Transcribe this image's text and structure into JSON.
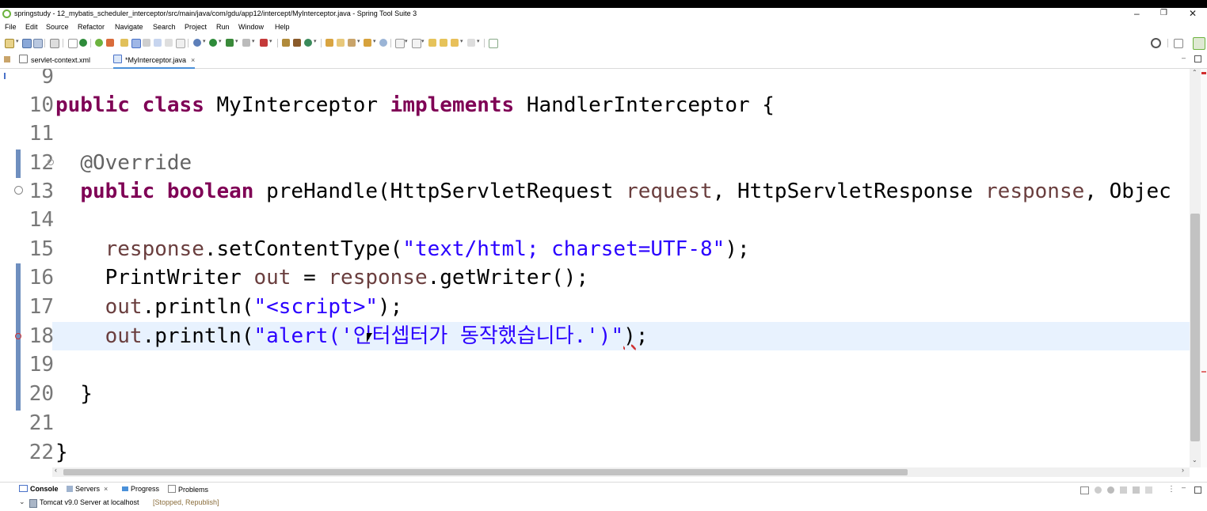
{
  "window": {
    "title": "springstudy - 12_mybatis_scheduler_interceptor/src/main/java/com/gdu/app12/intercept/MyInterceptor.java - Spring Tool Suite 3",
    "minimize": "–",
    "maximize": "❐",
    "close": "✕"
  },
  "menu": [
    "File",
    "Edit",
    "Source",
    "Refactor",
    "Navigate",
    "Search",
    "Project",
    "Run",
    "Window",
    "Help"
  ],
  "tabs": [
    {
      "label": "servlet-context.xml",
      "icon": "xml-file-icon"
    },
    {
      "label": "*MyInterceptor.java",
      "icon": "java-file-icon",
      "close": "×"
    }
  ],
  "editor": {
    "lines": [
      {
        "num": "9",
        "code": ""
      },
      {
        "num": "10",
        "code": "public class MyInterceptor implements HandlerInterceptor {"
      },
      {
        "num": "11",
        "code": ""
      },
      {
        "num": "12",
        "code": "  @Override"
      },
      {
        "num": "13",
        "code": "  public boolean preHandle(HttpServletRequest request, HttpServletResponse response, Objec"
      },
      {
        "num": "14",
        "code": ""
      },
      {
        "num": "15",
        "code": "    response.setContentType(\"text/html; charset=UTF-8\");"
      },
      {
        "num": "16",
        "code": "    PrintWriter out = response.getWriter();"
      },
      {
        "num": "17",
        "code": "    out.println(\"<script>\");"
      },
      {
        "num": "18",
        "code": "    out.println(\"alert('인터셉터가 동작했습니다.')\");"
      },
      {
        "num": "19",
        "code": ""
      },
      {
        "num": "20",
        "code": "  }"
      },
      {
        "num": "21",
        "code": ""
      },
      {
        "num": "22",
        "code": "}"
      }
    ],
    "current_line": "18"
  },
  "bottom_panel": {
    "tabs": [
      "Console",
      "Servers",
      "Progress",
      "Problems"
    ],
    "server_name": "Tomcat v9.0 Server at localhost",
    "server_state": "[Stopped, Republish]"
  },
  "colors": {
    "keyword": "#7f0055",
    "string": "#2a00ff",
    "variable": "#6a3e3e",
    "annotation": "#646464",
    "current_line": "#e8f2fe"
  }
}
